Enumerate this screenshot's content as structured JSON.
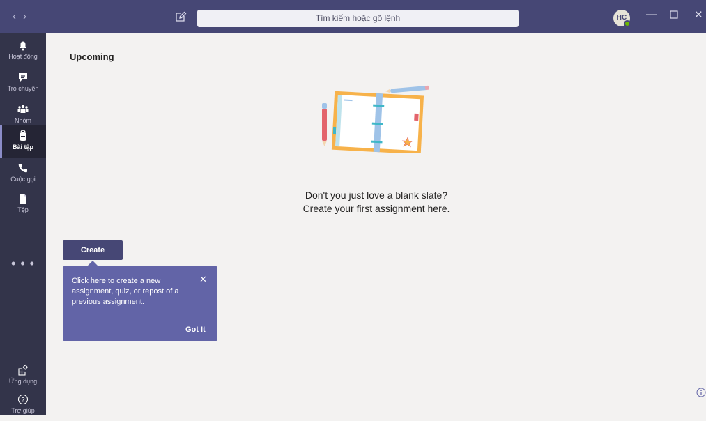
{
  "titlebar": {
    "nav_back_icon": "chevron-left-icon",
    "nav_forward_icon": "chevron-right-icon",
    "compose_icon": "compose-icon",
    "search_placeholder": "Tìm kiếm hoặc gõ lệnh",
    "avatar_initials": "HC",
    "status_color": "#6bb700"
  },
  "sidebar": {
    "items": [
      {
        "label": "Hoạt động",
        "icon": "bell-icon"
      },
      {
        "label": "Trò chuyện",
        "icon": "chat-icon"
      },
      {
        "label": "Nhóm",
        "icon": "teams-icon"
      },
      {
        "label": "Bài tập",
        "icon": "backpack-icon",
        "active": true
      },
      {
        "label": "Cuộc gọi",
        "icon": "phone-icon"
      },
      {
        "label": "Tệp",
        "icon": "file-icon"
      }
    ],
    "more": "• • •",
    "bottom": [
      {
        "label": "Ứng dụng",
        "icon": "apps-icon"
      },
      {
        "label": "Trợ giúp",
        "icon": "help-icon"
      }
    ]
  },
  "main": {
    "section_title": "Upcoming",
    "empty_line1": "Don't you just love a blank slate?",
    "empty_line2": "Create your first assignment here.",
    "create_label": "Create"
  },
  "tooltip": {
    "text": "Click here to create a new assignment, quiz, or repost of a previous assignment.",
    "close": "✕",
    "got_it": "Got It"
  },
  "colors": {
    "brand": "#464775",
    "rail": "#33344a",
    "tooltip": "#6264a7"
  }
}
